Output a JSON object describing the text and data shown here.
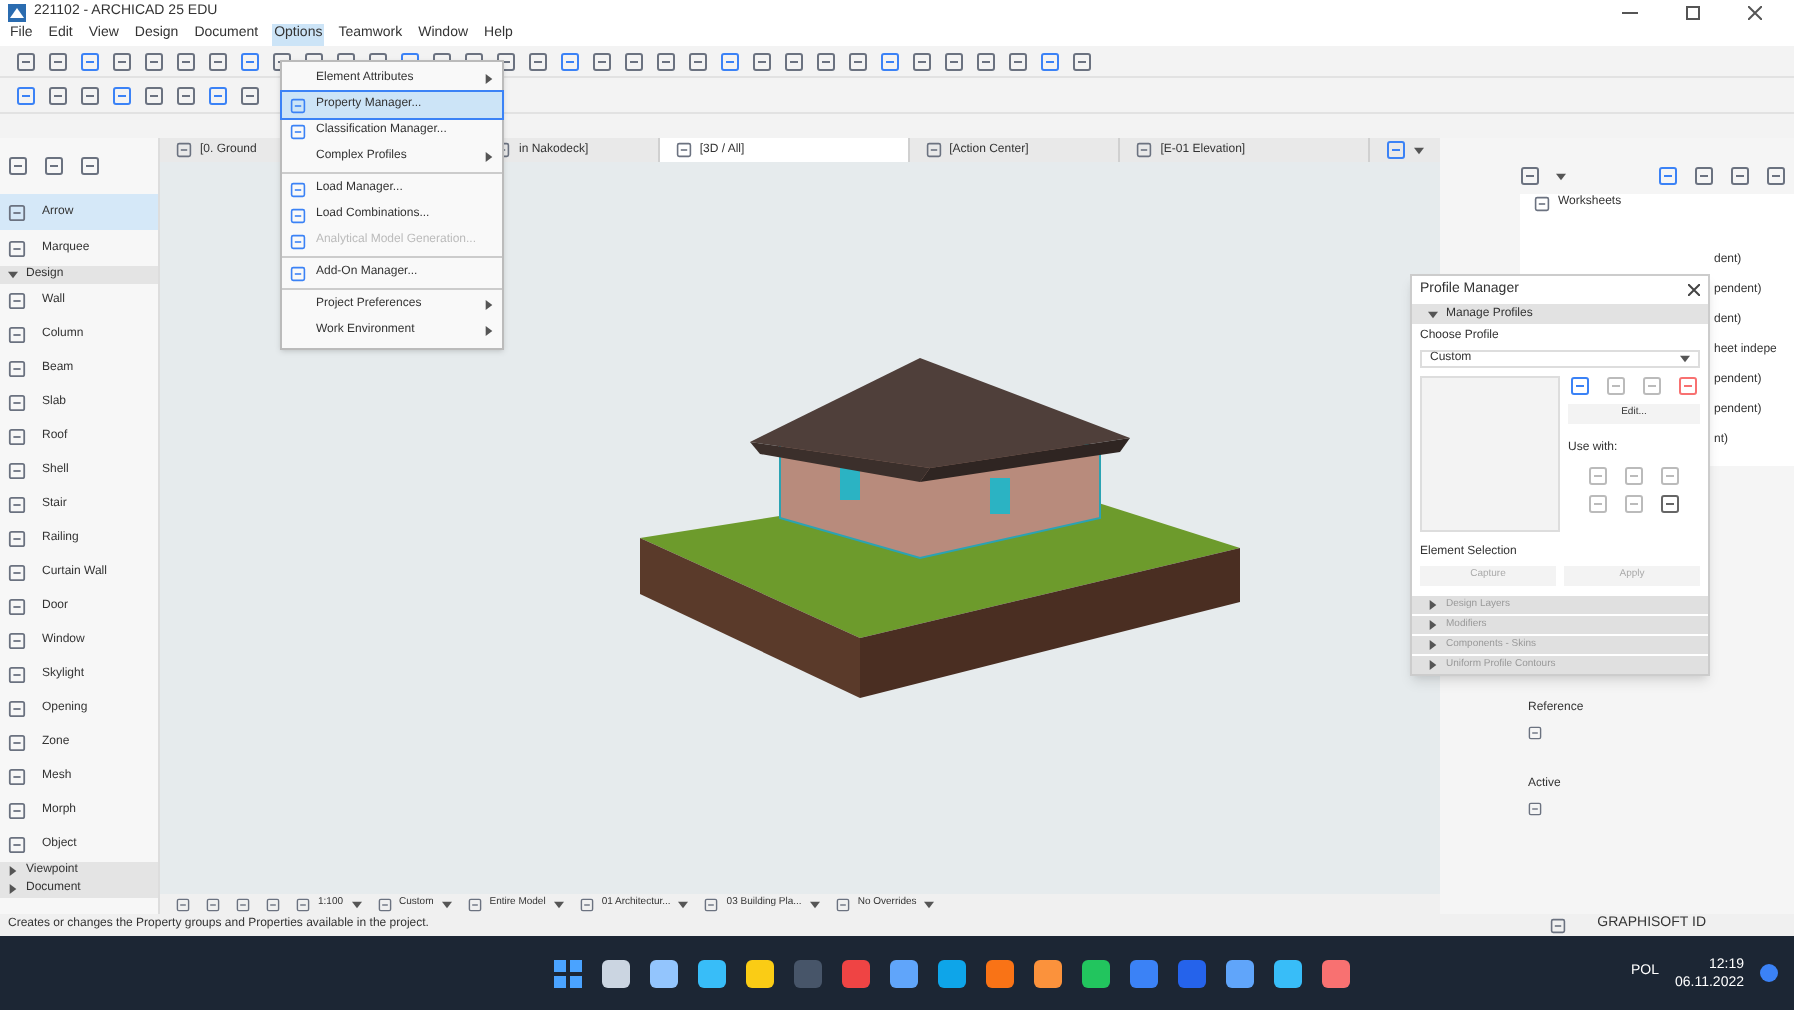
{
  "window": {
    "title": "221102 - ARCHICAD 25 EDU"
  },
  "menu_bar": [
    {
      "label": "File",
      "selected": false
    },
    {
      "label": "Edit",
      "selected": false
    },
    {
      "label": "View",
      "selected": false
    },
    {
      "label": "Design",
      "selected": false
    },
    {
      "label": "Document",
      "selected": false
    },
    {
      "label": "Options",
      "selected": true
    },
    {
      "label": "Teamwork",
      "selected": false
    },
    {
      "label": "Window",
      "selected": false
    },
    {
      "label": "Help",
      "selected": false
    }
  ],
  "options_menu": [
    {
      "kind": "plain",
      "label": "Element Attributes",
      "submenu": true,
      "highlighted": false,
      "disabled": false
    },
    {
      "kind": "icon",
      "label": "Property Manager...",
      "submenu": false,
      "highlighted": true,
      "disabled": false
    },
    {
      "kind": "icon",
      "label": "Classification Manager...",
      "submenu": false,
      "highlighted": false,
      "disabled": false
    },
    {
      "kind": "plain",
      "label": "Complex Profiles",
      "submenu": true,
      "highlighted": false,
      "disabled": false
    },
    {
      "kind": "separator"
    },
    {
      "kind": "icon",
      "label": "Load Manager...",
      "submenu": false,
      "highlighted": false,
      "disabled": false
    },
    {
      "kind": "icon",
      "label": "Load Combinations...",
      "submenu": false,
      "highlighted": false,
      "disabled": false
    },
    {
      "kind": "icon",
      "label": "Analytical Model Generation...",
      "submenu": false,
      "highlighted": false,
      "disabled": true
    },
    {
      "kind": "separator"
    },
    {
      "kind": "icon",
      "label": "Add-On Manager...",
      "submenu": false,
      "highlighted": false,
      "disabled": false
    },
    {
      "kind": "separator"
    },
    {
      "kind": "plain",
      "label": "Project Preferences",
      "submenu": true,
      "highlighted": false,
      "disabled": false
    },
    {
      "kind": "plain",
      "label": "Work Environment",
      "submenu": true,
      "highlighted": false,
      "disabled": false
    }
  ],
  "tabs": [
    {
      "label": "[0. Ground",
      "selected": false
    },
    {
      "label": "in Nakodeck]",
      "selected": false
    },
    {
      "label": "[3D / All]",
      "selected": true
    },
    {
      "label": "[Action Center]",
      "selected": false
    },
    {
      "label": "[E-01 Elevation]",
      "selected": false
    }
  ],
  "toolbox": {
    "items": [
      {
        "label": "Arrow",
        "selected": true
      },
      {
        "label": "Marquee",
        "selected": false
      }
    ],
    "sections": [
      {
        "label": "Design",
        "expanded": true,
        "tools": [
          "Wall",
          "Column",
          "Beam",
          "Slab",
          "Roof",
          "Shell",
          "Stair",
          "Railing",
          "Curtain Wall",
          "Door",
          "Window",
          "Skylight",
          "Opening",
          "Zone",
          "Mesh",
          "Morph",
          "Object"
        ]
      },
      {
        "label": "Viewpoint",
        "expanded": false
      },
      {
        "label": "Document",
        "expanded": false
      }
    ]
  },
  "navigator": {
    "root": "Worksheets",
    "rows": [
      "dent)",
      "pendent)",
      "dent)",
      "heet indepe",
      "pendent)",
      "pendent)",
      "nt)"
    ],
    "labels": [
      "Reference",
      "Active"
    ]
  },
  "profile_manager": {
    "title": "Profile Manager",
    "section": {
      "label": "Manage Profiles",
      "expanded": true
    },
    "choose_label": "Choose Profile",
    "profile": "Custom",
    "edit_button": "Edit...",
    "use_with": "Use with:",
    "selection_label": "Element Selection",
    "buttons": [
      {
        "label": "Capture",
        "disabled": true
      },
      {
        "label": "Apply",
        "disabled": true
      }
    ],
    "panels": [
      {
        "label": "Design Layers",
        "expanded": false
      },
      {
        "label": "Modifiers",
        "expanded": false
      },
      {
        "label": "Components - Skins",
        "expanded": false
      },
      {
        "label": "Uniform Profile Contours",
        "expanded": false
      }
    ]
  },
  "bottom_toolbar": [
    {
      "label": "1:100",
      "kind": "dropdown"
    },
    {
      "label": "Custom",
      "kind": "dropdown"
    },
    {
      "label": "Entire Model",
      "kind": "dropdown"
    },
    {
      "label": "01 Architectur...",
      "kind": "dropdown"
    },
    {
      "label": "03 Building Pla...",
      "kind": "dropdown"
    },
    {
      "label": "No Overrides",
      "kind": "dropdown"
    }
  ],
  "status_bar": {
    "text": "Creates or changes the Property groups and Properties available in the project.",
    "account": "GRAPHISOFT ID"
  },
  "taskbar": {
    "language": "POL",
    "time": "12:19",
    "date": "06.11.2022"
  }
}
